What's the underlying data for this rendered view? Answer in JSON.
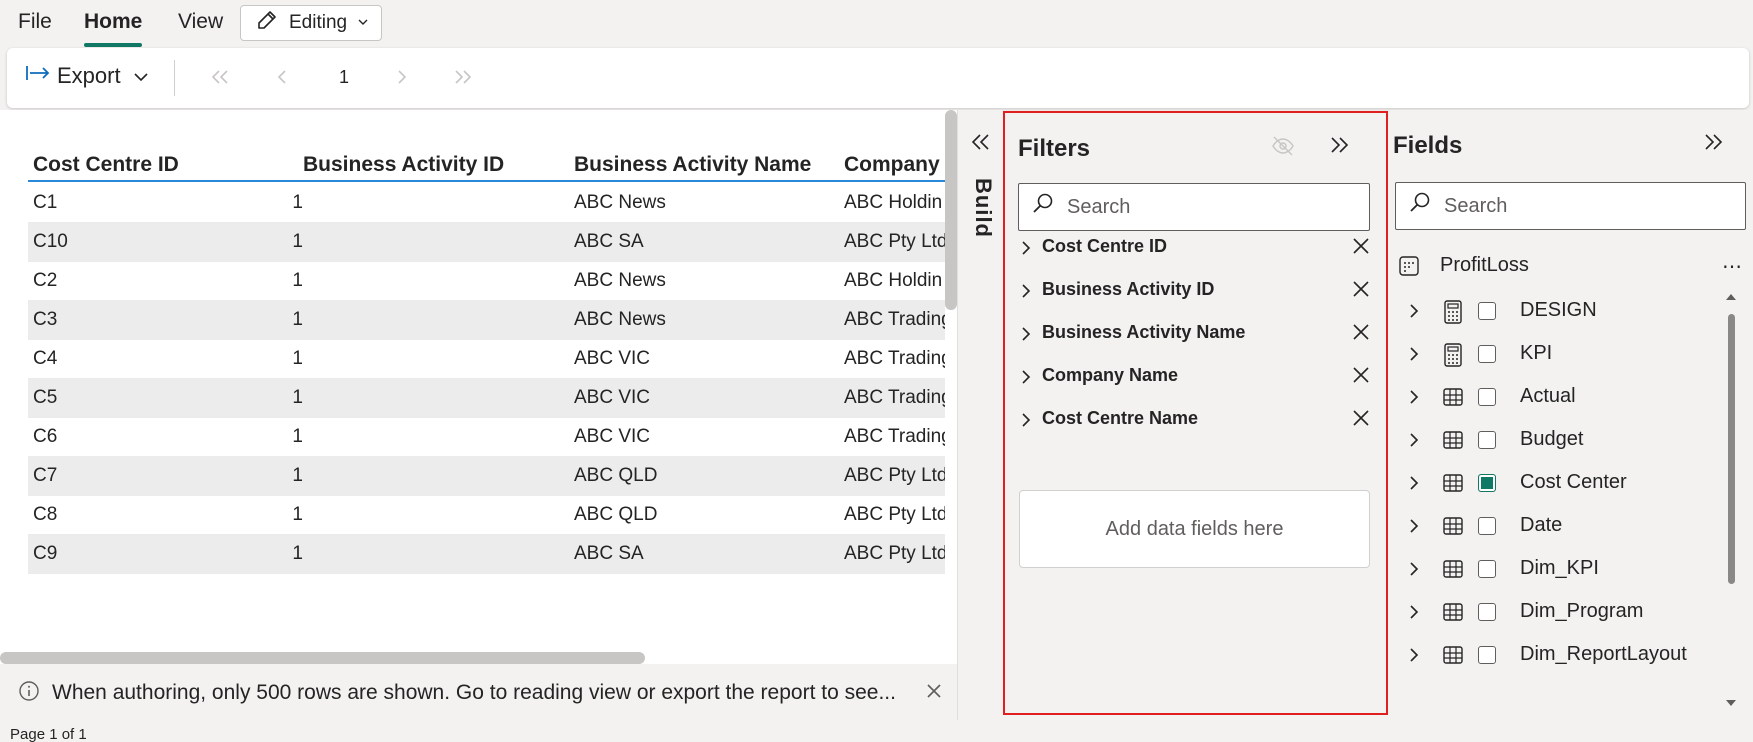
{
  "menu": {
    "file": "File",
    "home": "Home",
    "view": "View",
    "editing": "Editing"
  },
  "toolbar": {
    "export_label": "Export",
    "page_number": "1"
  },
  "table": {
    "headers": [
      "Cost Centre ID",
      "Business Activity ID",
      "Business Activity Name",
      "Company"
    ],
    "rows": [
      [
        "C1",
        "1",
        "ABC News",
        "ABC Holdin"
      ],
      [
        "C10",
        "1",
        "ABC SA",
        "ABC Pty Ltd"
      ],
      [
        "C2",
        "1",
        "ABC News",
        "ABC Holdin"
      ],
      [
        "C3",
        "1",
        "ABC News",
        "ABC Trading"
      ],
      [
        "C4",
        "1",
        "ABC VIC",
        "ABC Trading"
      ],
      [
        "C5",
        "1",
        "ABC VIC",
        "ABC Trading"
      ],
      [
        "C6",
        "1",
        "ABC VIC",
        "ABC Trading"
      ],
      [
        "C7",
        "1",
        "ABC QLD",
        "ABC Pty Ltd"
      ],
      [
        "C8",
        "1",
        "ABC QLD",
        "ABC Pty Ltd"
      ],
      [
        "C9",
        "1",
        "ABC SA",
        "ABC Pty Ltd"
      ]
    ]
  },
  "info_message": "When authoring, only 500 rows are shown. Go to reading view or export the report to see...",
  "status_bar": "Page 1 of 1",
  "build": {
    "label": "Build"
  },
  "filters": {
    "title": "Filters",
    "search_placeholder": "Search",
    "items": [
      "Cost Centre ID",
      "Business Activity ID",
      "Business Activity Name",
      "Company Name",
      "Cost Centre Name"
    ],
    "drop_zone": "Add data fields here"
  },
  "fields": {
    "title": "Fields",
    "search_placeholder": "Search",
    "model": "ProfitLoss",
    "items": [
      {
        "label": "DESIGN",
        "icon": "calculator-icon",
        "checked": false
      },
      {
        "label": "KPI",
        "icon": "calculator-icon",
        "checked": false
      },
      {
        "label": "Actual",
        "icon": "table-icon",
        "checked": false
      },
      {
        "label": "Budget",
        "icon": "table-icon",
        "checked": false
      },
      {
        "label": "Cost Center",
        "icon": "table-icon",
        "checked": true
      },
      {
        "label": "Date",
        "icon": "table-icon",
        "checked": false
      },
      {
        "label": "Dim_KPI",
        "icon": "table-icon",
        "checked": false
      },
      {
        "label": "Dim_Program",
        "icon": "table-icon",
        "checked": false
      },
      {
        "label": "Dim_ReportLayout",
        "icon": "table-icon",
        "checked": false
      }
    ]
  },
  "colors": {
    "accent": "#117865",
    "header_line": "#2b88d8",
    "filters_border": "#e02020"
  }
}
